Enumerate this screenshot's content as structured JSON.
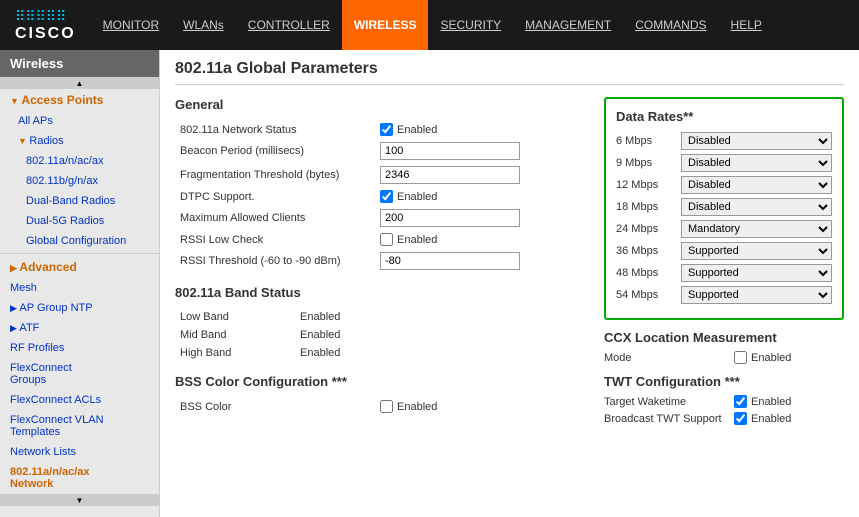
{
  "header": {
    "logo_dots": ".....",
    "logo_name": "CISCO",
    "nav_items": [
      {
        "label": "MONITOR",
        "active": false
      },
      {
        "label": "WLANs",
        "active": false
      },
      {
        "label": "CONTROLLER",
        "active": false
      },
      {
        "label": "WIRELESS",
        "active": true
      },
      {
        "label": "SECURITY",
        "active": false
      },
      {
        "label": "MANAGEMENT",
        "active": false
      },
      {
        "label": "COMMANDS",
        "active": false
      },
      {
        "label": "HELP",
        "active": false
      }
    ]
  },
  "sidebar": {
    "title": "Wireless",
    "items": [
      {
        "label": "Access Points",
        "type": "parent",
        "indent": 0,
        "arrow": "expanded"
      },
      {
        "label": "All APs",
        "type": "link",
        "indent": 1
      },
      {
        "label": "Radios",
        "type": "parent-sub",
        "indent": 1,
        "arrow": "expanded"
      },
      {
        "label": "802.11a/n/ac/ax",
        "type": "link",
        "indent": 2
      },
      {
        "label": "802.11b/g/n/ax",
        "type": "link",
        "indent": 2
      },
      {
        "label": "Dual-Band Radios",
        "type": "link",
        "indent": 2
      },
      {
        "label": "Dual-5G Radios",
        "type": "link",
        "indent": 2
      },
      {
        "label": "Global Configuration",
        "type": "link",
        "indent": 2
      },
      {
        "label": "Advanced",
        "type": "parent",
        "indent": 0,
        "arrow": "collapsed"
      },
      {
        "label": "Mesh",
        "type": "link",
        "indent": 0
      },
      {
        "label": "AP Group NTP",
        "type": "parent",
        "indent": 0,
        "arrow": "collapsed"
      },
      {
        "label": "ATF",
        "type": "parent",
        "indent": 0,
        "arrow": "collapsed"
      },
      {
        "label": "RF Profiles",
        "type": "link",
        "indent": 0
      },
      {
        "label": "FlexConnect Groups",
        "type": "link",
        "indent": 0
      },
      {
        "label": "FlexConnect ACLs",
        "type": "link",
        "indent": 0
      },
      {
        "label": "FlexConnect VLAN Templates",
        "type": "link",
        "indent": 0
      },
      {
        "label": "Network Lists",
        "type": "link",
        "indent": 0
      },
      {
        "label": "802.11a/n/ac/ax Network",
        "type": "active",
        "indent": 0
      }
    ]
  },
  "page_title": "802.11a Global Parameters",
  "general": {
    "title": "General",
    "fields": [
      {
        "label": "802.11a Network Status",
        "type": "checkbox",
        "checked": true,
        "value": "Enabled"
      },
      {
        "label": "Beacon Period (millisecs)",
        "type": "input",
        "value": "100"
      },
      {
        "label": "Fragmentation Threshold (bytes)",
        "type": "input",
        "value": "2346"
      },
      {
        "label": "DTPC Support.",
        "type": "checkbox",
        "checked": true,
        "value": "Enabled"
      },
      {
        "label": "Maximum Allowed Clients",
        "type": "input",
        "value": "200"
      },
      {
        "label": "RSSI Low Check",
        "type": "checkbox",
        "checked": false,
        "value": "Enabled"
      },
      {
        "label": "RSSI Threshold (-60 to -90 dBm)",
        "type": "input",
        "value": "-80"
      }
    ]
  },
  "band_status": {
    "title": "802.11a Band Status",
    "bands": [
      {
        "label": "Low Band",
        "status": "Enabled"
      },
      {
        "label": "Mid Band",
        "status": "Enabled"
      },
      {
        "label": "High Band",
        "status": "Enabled"
      }
    ]
  },
  "bss_color": {
    "title": "BSS Color Configuration ***",
    "field_label": "BSS Color",
    "checked": false,
    "value": "Enabled"
  },
  "data_rates": {
    "title": "Data Rates**",
    "rates": [
      {
        "label": "6 Mbps",
        "value": "Disabled"
      },
      {
        "label": "9 Mbps",
        "value": "Disabled"
      },
      {
        "label": "12 Mbps",
        "value": "Disabled"
      },
      {
        "label": "18 Mbps",
        "value": "Disabled"
      },
      {
        "label": "24 Mbps",
        "value": "Mandatory"
      },
      {
        "label": "36 Mbps",
        "value": "Supported"
      },
      {
        "label": "48 Mbps",
        "value": "Supported"
      },
      {
        "label": "54 Mbps",
        "value": "Supported"
      }
    ],
    "options": [
      "Disabled",
      "Mandatory",
      "Supported"
    ]
  },
  "ccx": {
    "title": "CCX Location Measurement",
    "mode_label": "Mode",
    "checked": false,
    "value": "Enabled"
  },
  "twt": {
    "title": "TWT Configuration ***",
    "fields": [
      {
        "label": "Target Waketime",
        "checked": true,
        "value": "Enabled"
      },
      {
        "label": "Broadcast TWT Support",
        "checked": true,
        "value": "Enabled"
      }
    ]
  }
}
